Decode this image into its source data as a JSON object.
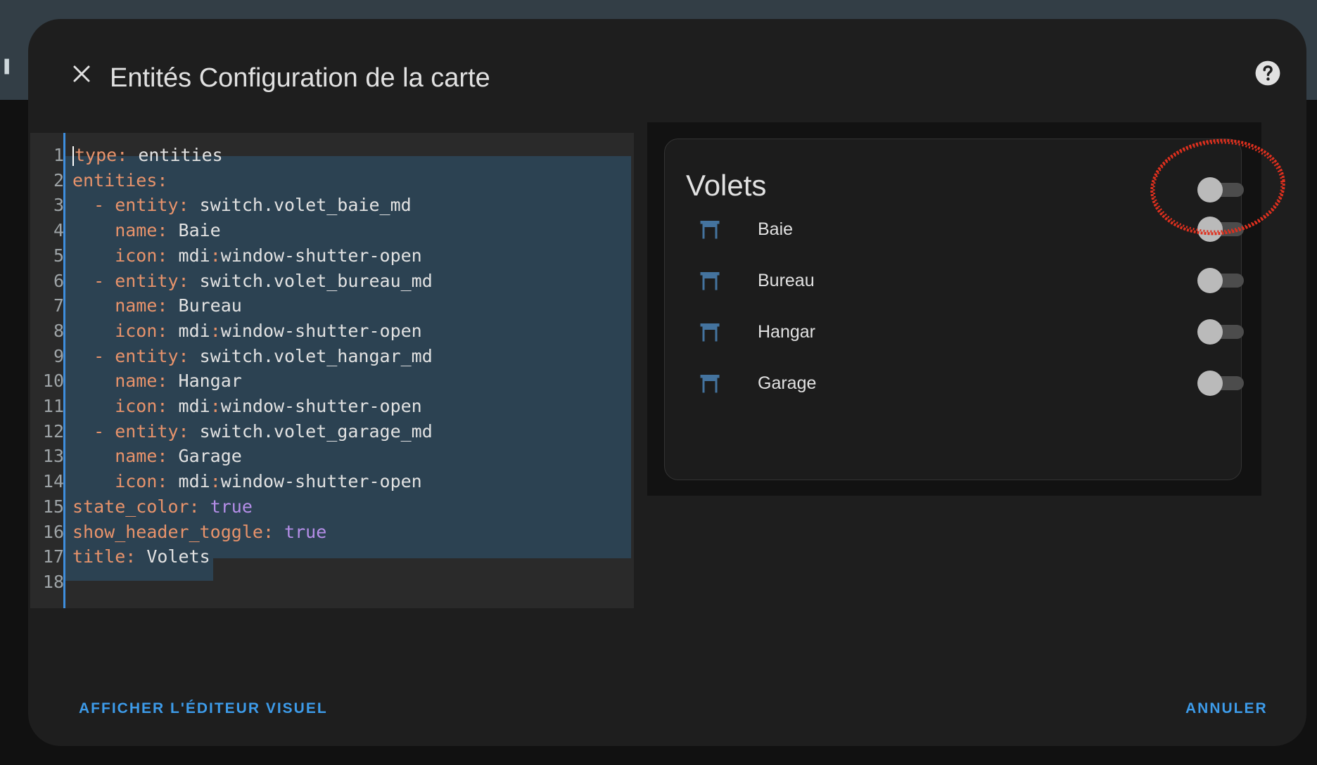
{
  "dialog": {
    "title": "Entités Configuration de la carte",
    "close_icon": "close-icon",
    "help_icon": "help-circle-icon"
  },
  "editor": {
    "lines": [
      {
        "no": "1",
        "segments": [
          {
            "t": "type",
            "c": "k"
          },
          {
            "t": ": ",
            "c": "p"
          },
          {
            "t": "entities",
            "c": ""
          }
        ]
      },
      {
        "no": "2",
        "segments": [
          {
            "t": "entities",
            "c": "k"
          },
          {
            "t": ":",
            "c": "p"
          }
        ]
      },
      {
        "no": "3",
        "segments": [
          {
            "t": "  - ",
            "c": "p"
          },
          {
            "t": "entity",
            "c": "k"
          },
          {
            "t": ": ",
            "c": "p"
          },
          {
            "t": "switch.volet_baie_md",
            "c": ""
          }
        ]
      },
      {
        "no": "4",
        "segments": [
          {
            "t": "    name",
            "c": "k"
          },
          {
            "t": ": ",
            "c": "p"
          },
          {
            "t": "Baie",
            "c": ""
          }
        ]
      },
      {
        "no": "5",
        "segments": [
          {
            "t": "    icon",
            "c": "k"
          },
          {
            "t": ": ",
            "c": "p"
          },
          {
            "t": "mdi",
            "c": ""
          },
          {
            "t": ":",
            "c": "p"
          },
          {
            "t": "window-shutter-open",
            "c": ""
          }
        ]
      },
      {
        "no": "6",
        "segments": [
          {
            "t": "  - ",
            "c": "p"
          },
          {
            "t": "entity",
            "c": "k"
          },
          {
            "t": ": ",
            "c": "p"
          },
          {
            "t": "switch.volet_bureau_md",
            "c": ""
          }
        ]
      },
      {
        "no": "7",
        "segments": [
          {
            "t": "    name",
            "c": "k"
          },
          {
            "t": ": ",
            "c": "p"
          },
          {
            "t": "Bureau",
            "c": ""
          }
        ]
      },
      {
        "no": "8",
        "segments": [
          {
            "t": "    icon",
            "c": "k"
          },
          {
            "t": ": ",
            "c": "p"
          },
          {
            "t": "mdi",
            "c": ""
          },
          {
            "t": ":",
            "c": "p"
          },
          {
            "t": "window-shutter-open",
            "c": ""
          }
        ]
      },
      {
        "no": "9",
        "segments": [
          {
            "t": "  - ",
            "c": "p"
          },
          {
            "t": "entity",
            "c": "k"
          },
          {
            "t": ": ",
            "c": "p"
          },
          {
            "t": "switch.volet_hangar_md",
            "c": ""
          }
        ]
      },
      {
        "no": "10",
        "segments": [
          {
            "t": "    name",
            "c": "k"
          },
          {
            "t": ": ",
            "c": "p"
          },
          {
            "t": "Hangar",
            "c": ""
          }
        ]
      },
      {
        "no": "11",
        "segments": [
          {
            "t": "    icon",
            "c": "k"
          },
          {
            "t": ": ",
            "c": "p"
          },
          {
            "t": "mdi",
            "c": ""
          },
          {
            "t": ":",
            "c": "p"
          },
          {
            "t": "window-shutter-open",
            "c": ""
          }
        ]
      },
      {
        "no": "12",
        "segments": [
          {
            "t": "  - ",
            "c": "p"
          },
          {
            "t": "entity",
            "c": "k"
          },
          {
            "t": ": ",
            "c": "p"
          },
          {
            "t": "switch.volet_garage_md",
            "c": ""
          }
        ]
      },
      {
        "no": "13",
        "segments": [
          {
            "t": "    name",
            "c": "k"
          },
          {
            "t": ": ",
            "c": "p"
          },
          {
            "t": "Garage",
            "c": ""
          }
        ]
      },
      {
        "no": "14",
        "segments": [
          {
            "t": "    icon",
            "c": "k"
          },
          {
            "t": ": ",
            "c": "p"
          },
          {
            "t": "mdi",
            "c": ""
          },
          {
            "t": ":",
            "c": "p"
          },
          {
            "t": "window-shutter-open",
            "c": ""
          }
        ]
      },
      {
        "no": "15",
        "segments": [
          {
            "t": "state_color",
            "c": "k"
          },
          {
            "t": ": ",
            "c": "p"
          },
          {
            "t": "true",
            "c": "b"
          }
        ]
      },
      {
        "no": "16",
        "segments": [
          {
            "t": "show_header_toggle",
            "c": "k"
          },
          {
            "t": ": ",
            "c": "p"
          },
          {
            "t": "true",
            "c": "b"
          }
        ]
      },
      {
        "no": "17",
        "segments": [
          {
            "t": "title",
            "c": "k"
          },
          {
            "t": ": ",
            "c": "p"
          },
          {
            "t": "Volets",
            "c": ""
          }
        ]
      },
      {
        "no": "18",
        "segments": []
      }
    ]
  },
  "preview": {
    "card_title": "Volets",
    "header_toggle_on": false,
    "entities": [
      {
        "name": "Baie",
        "icon": "window-shutter-open-icon",
        "on": false
      },
      {
        "name": "Bureau",
        "icon": "window-shutter-open-icon",
        "on": false
      },
      {
        "name": "Hangar",
        "icon": "window-shutter-open-icon",
        "on": false
      },
      {
        "name": "Garage",
        "icon": "window-shutter-open-icon",
        "on": false
      }
    ]
  },
  "footer": {
    "visual_editor_label": "AFFICHER L'ÉDITEUR VISUEL",
    "cancel_label": "ANNULER"
  },
  "colors": {
    "accent": "#3d9be9",
    "yaml_key": "#e8936b",
    "yaml_bool": "#b58ee8",
    "icon": "#44739e",
    "annotation": "#e0301e"
  }
}
